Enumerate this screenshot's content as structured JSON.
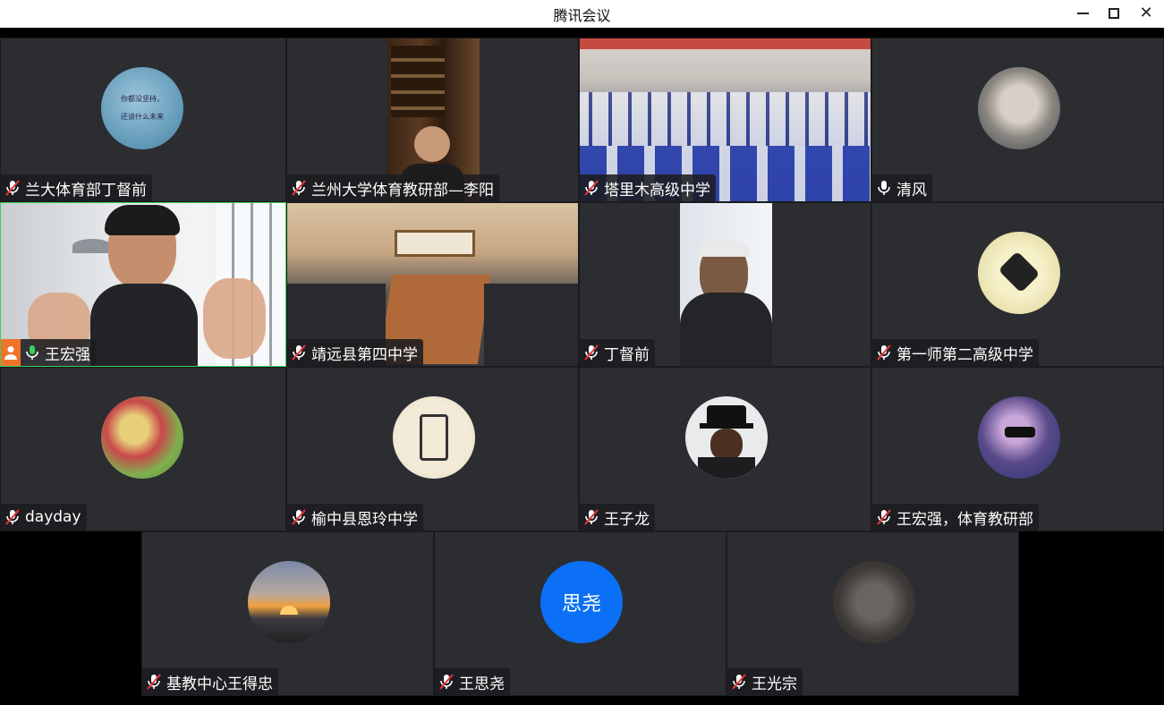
{
  "window": {
    "title": "腾讯会议"
  },
  "colors": {
    "tile_bg": "#2b2d31",
    "active_border": "#37d05b",
    "initial_avatar_bg": "#0b70f5",
    "mic_active": "#37d05b",
    "badge_orange": "#f0732b"
  },
  "participants": [
    {
      "name": "兰大体育部丁督前",
      "mic": "muted"
    },
    {
      "name": "兰州大学体育教研部—李阳",
      "mic": "muted"
    },
    {
      "name": "塔里木高级中学",
      "mic": "muted"
    },
    {
      "name": "清风",
      "mic": "on"
    },
    {
      "name": "王宏强",
      "mic": "speaking"
    },
    {
      "name": "靖远县第四中学",
      "mic": "muted"
    },
    {
      "name": "丁督前",
      "mic": "muted"
    },
    {
      "name": "第一师第二高级中学",
      "mic": "muted"
    },
    {
      "name": "dayday",
      "mic": "muted"
    },
    {
      "name": "榆中县恩玲中学",
      "mic": "muted"
    },
    {
      "name": "王子龙",
      "mic": "muted"
    },
    {
      "name": "王宏强，体育教研部",
      "mic": "muted"
    },
    {
      "name": "基教中心王得忠",
      "mic": "muted"
    },
    {
      "name": "王思尧",
      "mic": "muted",
      "initials": "思尧"
    },
    {
      "name": "王光宗",
      "mic": "muted"
    }
  ],
  "tile1_avatar_text": [
    "你都没坚持，",
    "还谈什么未来"
  ]
}
